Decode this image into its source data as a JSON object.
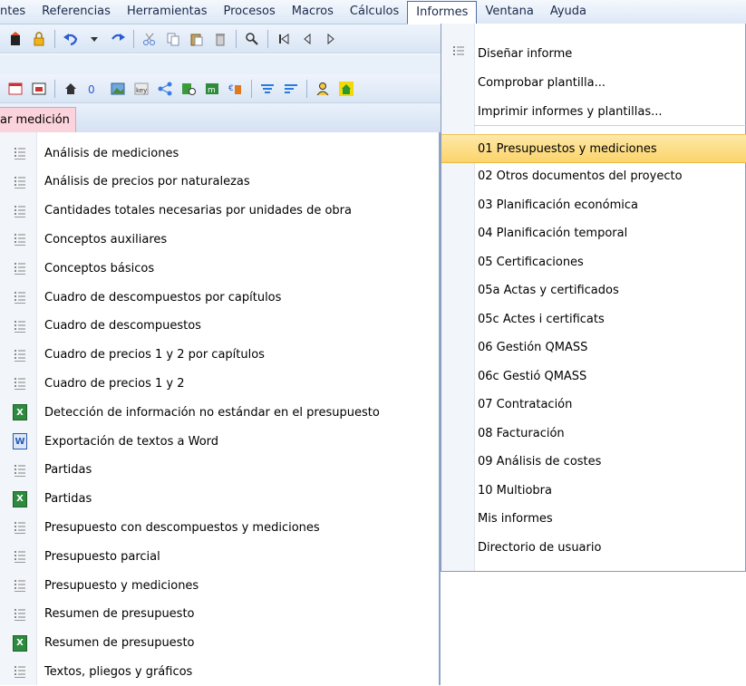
{
  "menubar": {
    "items": [
      "ntes",
      "Referencias",
      "Herramientas",
      "Procesos",
      "Macros",
      "Cálculos",
      "Informes",
      "Ventana",
      "Ayuda"
    ]
  },
  "tab": {
    "label": "ar medición"
  },
  "left_menu": {
    "items": [
      {
        "label": "Análisis de mediciones",
        "icon": "list-icon"
      },
      {
        "label": "Análisis de precios por naturalezas",
        "icon": "list-icon"
      },
      {
        "label": "Cantidades totales necesarias por unidades de obra",
        "icon": "list-icon"
      },
      {
        "label": "Conceptos auxiliares",
        "icon": "list-icon"
      },
      {
        "label": "Conceptos básicos",
        "icon": "list-icon"
      },
      {
        "label": "Cuadro de descompuestos por capítulos",
        "icon": "list-icon"
      },
      {
        "label": "Cuadro de descompuestos",
        "icon": "list-icon"
      },
      {
        "label": "Cuadro de precios 1 y 2 por capítulos",
        "icon": "list-icon"
      },
      {
        "label": "Cuadro de precios 1 y 2",
        "icon": "list-icon"
      },
      {
        "label": "Detección de información no estándar en el presupuesto",
        "icon": "excel-icon"
      },
      {
        "label": "Exportación de textos a Word",
        "icon": "word-icon"
      },
      {
        "label": "Partidas",
        "icon": "list-icon"
      },
      {
        "label": "Partidas",
        "icon": "excel-icon"
      },
      {
        "label": "Presupuesto con descompuestos y mediciones",
        "icon": "list-icon"
      },
      {
        "label": "Presupuesto parcial",
        "icon": "list-icon"
      },
      {
        "label": "Presupuesto y mediciones",
        "icon": "list-icon"
      },
      {
        "label": "Resumen de presupuesto",
        "icon": "list-icon"
      },
      {
        "label": "Resumen de presupuesto",
        "icon": "excel-icon"
      },
      {
        "label": "Textos, pliegos y gráficos",
        "icon": "list-icon"
      }
    ]
  },
  "informes_menu": {
    "top_items": [
      {
        "label": "Diseñar informe",
        "icon": "list-icon"
      },
      {
        "label": "Comprobar plantilla..."
      },
      {
        "label": "Imprimir informes y plantillas..."
      }
    ],
    "items": [
      "01 Presupuestos y mediciones",
      "02 Otros documentos del proyecto",
      "03 Planificación económica",
      "04 Planificación temporal",
      "05 Certificaciones",
      "05a Actas y certificados",
      "05c Actes i certificats",
      "06 Gestión QMASS",
      "06c Gestió QMASS",
      "07 Contratación",
      "08 Facturación",
      "09 Análisis de costes",
      "10 Multiobra",
      "Mis informes",
      "Directorio de usuario"
    ],
    "highlighted_index": 0
  },
  "colors": {
    "highlight": "#fbd46b",
    "tab": "#fbd3dc",
    "menubar": "#dde8f6"
  }
}
